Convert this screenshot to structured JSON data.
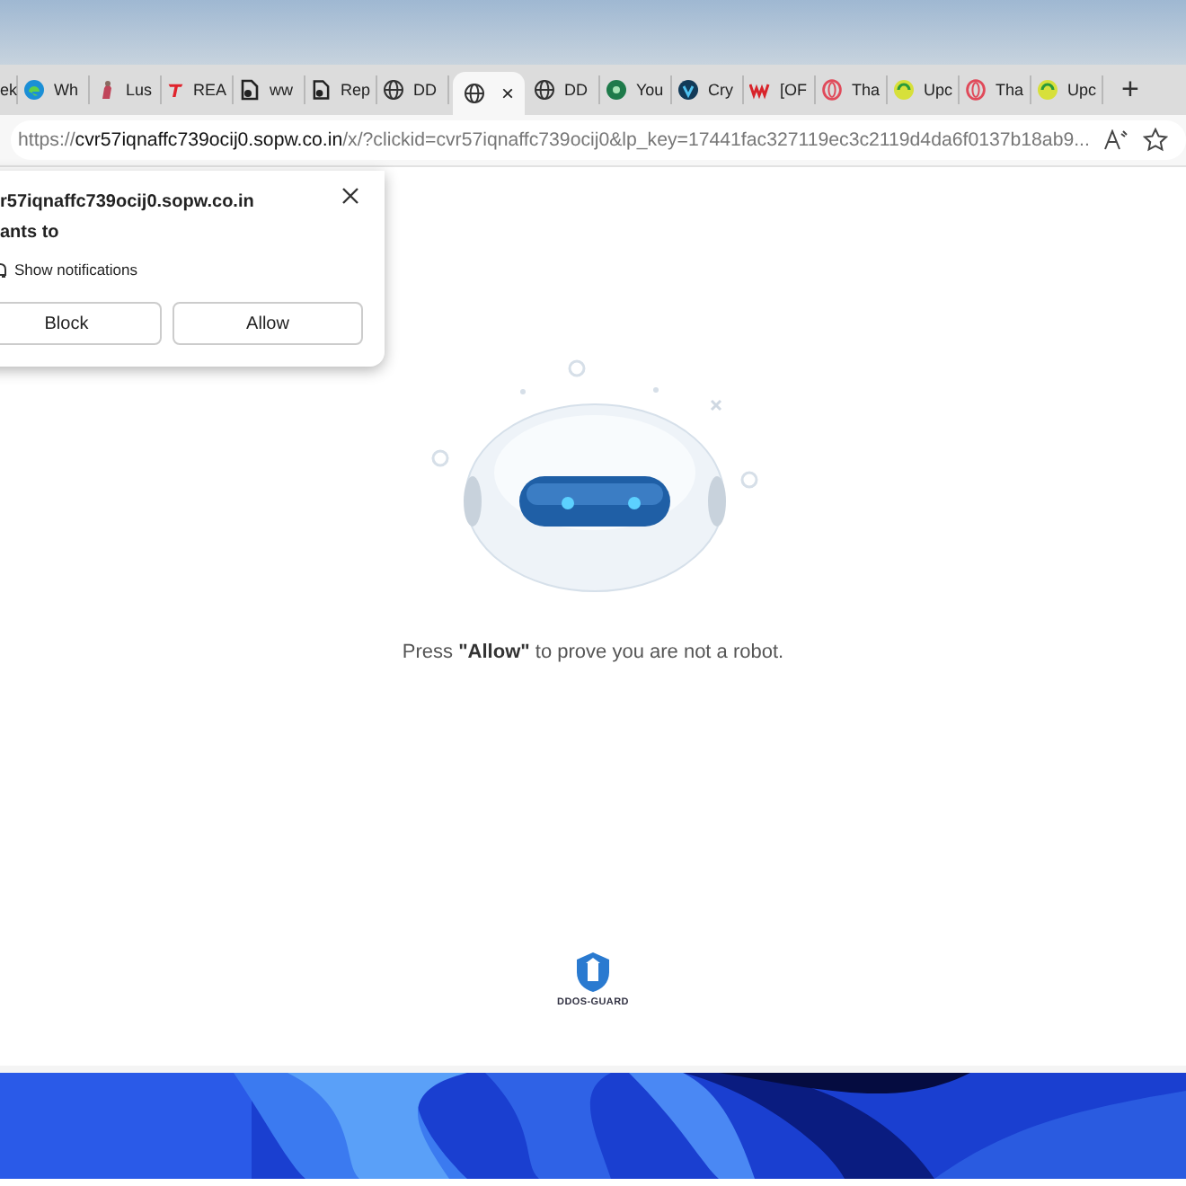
{
  "tabs": [
    {
      "label": "ek",
      "kind": "plain",
      "selected": false
    },
    {
      "label": "Wh",
      "kind": "edge",
      "selected": false
    },
    {
      "label": "Lus",
      "kind": "figure",
      "selected": false
    },
    {
      "label": "REA",
      "kind": "tlogo",
      "selected": false
    },
    {
      "label": "ww",
      "kind": "file",
      "selected": false
    },
    {
      "label": "Rep",
      "kind": "file",
      "selected": false
    },
    {
      "label": "DD",
      "kind": "globe",
      "selected": false
    },
    {
      "kind": "globe",
      "selected": true,
      "close": "×"
    },
    {
      "label": "DD",
      "kind": "globe",
      "selected": false
    },
    {
      "label": "You",
      "kind": "dot",
      "selected": false
    },
    {
      "label": "Cry",
      "kind": "vlogo",
      "selected": false
    },
    {
      "label": "[OF",
      "kind": "wlogo",
      "selected": false
    },
    {
      "label": "Tha",
      "kind": "ring",
      "selected": false
    },
    {
      "label": "Upc",
      "kind": "swirl",
      "selected": false
    },
    {
      "label": "Tha",
      "kind": "ring",
      "selected": false
    },
    {
      "label": "Upc",
      "kind": "swirl",
      "selected": false
    }
  ],
  "new_tab": "+",
  "address_bar": {
    "url": "https://**cvr57iqnaffc739ocij0.sopw.co.in**/x/?clickid=cvr57iqnaffc739ocij0&lp_key=17441fac327119ec3c2119d4da6f0137b18ab9..."
  },
  "permission_popup": {
    "site": "r57iqnaffc739ocij0.sopw.co.in",
    "wants": "ants to",
    "permission": "Show notifications",
    "buttons": [
      "Block",
      "Allow"
    ]
  },
  "page": {
    "message": "Press **\"Allow\"** to prove you are not a robot.",
    "logo_text": "DDOS-GUARD"
  }
}
